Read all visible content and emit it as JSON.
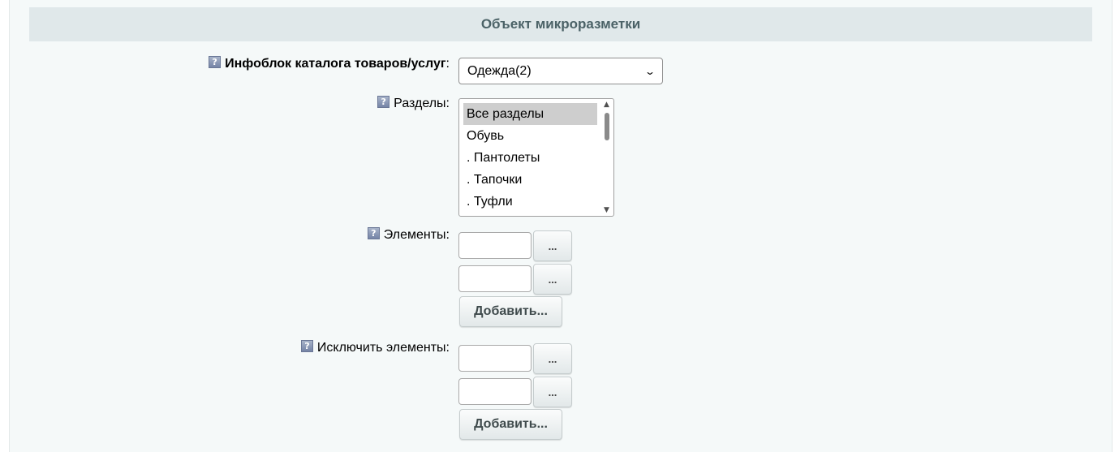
{
  "section": {
    "title": "Объект микроразметки"
  },
  "iblock": {
    "label": "Инфоблок каталога товаров/услуг",
    "colon": ":",
    "selected": "Одежда(2)"
  },
  "sections": {
    "label": "Разделы:",
    "items": [
      "Все разделы",
      "Обувь",
      ". Пантолеты",
      ". Тапочки",
      ". Туфли"
    ],
    "selected_index": 0
  },
  "elements": {
    "label": "Элементы:",
    "inputs": [
      "",
      ""
    ],
    "browse_label": "...",
    "add_label": "Добавить..."
  },
  "exclude": {
    "label": "Исключить элементы:",
    "inputs": [
      "",
      ""
    ],
    "browse_label": "...",
    "add_label": "Добавить..."
  },
  "icons": {
    "help": "help-icon",
    "select_arrow": "chevron-down-icon",
    "scroll_up": "scroll-up-arrow-icon",
    "scroll_down": "scroll-down-arrow-icon"
  },
  "colors": {
    "header_bg": "#e0e8ea",
    "header_text": "#4b6267",
    "panel_bg": "#f5f9f9",
    "selected_item_bg": "#cecece"
  }
}
